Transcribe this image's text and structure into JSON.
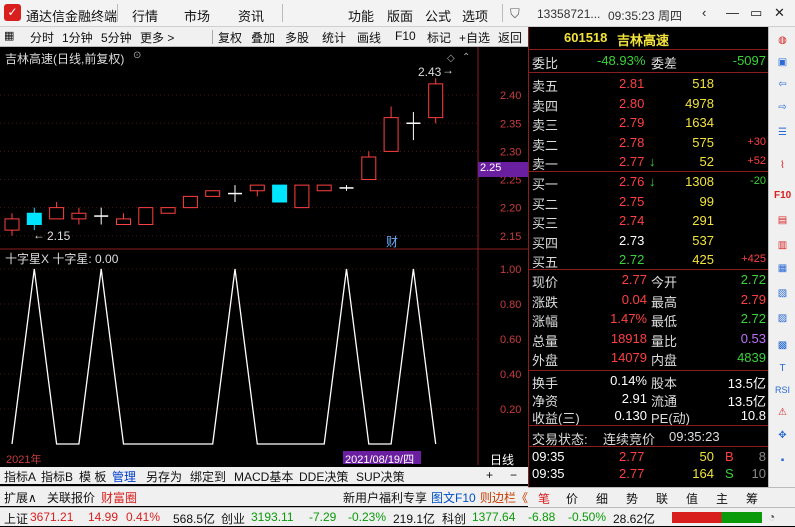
{
  "app": {
    "title": "通达信金融终端",
    "menus": [
      "行情",
      "市场",
      "资讯",
      "功能",
      "版面",
      "公式",
      "选项"
    ],
    "account": "13358721...",
    "clock": "09:35:23 周四"
  },
  "toolbar": [
    "分时",
    "1分钟",
    "5分钟",
    "更多 >",
    "复权",
    "叠加",
    "多股",
    "统计",
    "画线",
    "F10",
    "标记",
    "+自选",
    "返回"
  ],
  "chart": {
    "title": "吉林高速(日线,前复权)",
    "indicator_title": "十字星X  十字星: 0.00",
    "price_high_note": "2.43",
    "price_low_note": "2.15",
    "current_price_tag": "2.25",
    "finance_marker": "财",
    "year_label": "2021年",
    "cursor_date": "2021/08/19/四",
    "period_label": "日线",
    "y_labels": [
      "2.40",
      "2.35",
      "2.30",
      "2.25",
      "2.20",
      "2.15"
    ],
    "ind_labels": [
      "1.00",
      "0.80",
      "0.60",
      "0.40",
      "0.20"
    ]
  },
  "chart_data": {
    "type": "candlestick",
    "candles": [
      {
        "o": 2.16,
        "c": 2.18,
        "h": 2.19,
        "l": 2.15
      },
      {
        "o": 2.19,
        "c": 2.17,
        "h": 2.2,
        "l": 2.16
      },
      {
        "o": 2.18,
        "c": 2.2,
        "h": 2.21,
        "l": 2.18
      },
      {
        "o": 2.18,
        "c": 2.19,
        "h": 2.2,
        "l": 2.17
      },
      {
        "o": 2.185,
        "c": 2.185,
        "h": 2.2,
        "l": 2.17
      },
      {
        "o": 2.17,
        "c": 2.18,
        "h": 2.19,
        "l": 2.17
      },
      {
        "o": 2.17,
        "c": 2.2,
        "h": 2.2,
        "l": 2.17
      },
      {
        "o": 2.19,
        "c": 2.2,
        "h": 2.2,
        "l": 2.19
      },
      {
        "o": 2.2,
        "c": 2.22,
        "h": 2.22,
        "l": 2.2
      },
      {
        "o": 2.22,
        "c": 2.23,
        "h": 2.23,
        "l": 2.22
      },
      {
        "o": 2.225,
        "c": 2.225,
        "h": 2.24,
        "l": 2.21
      },
      {
        "o": 2.23,
        "c": 2.24,
        "h": 2.24,
        "l": 2.22
      },
      {
        "o": 2.24,
        "c": 2.21,
        "h": 2.24,
        "l": 2.21
      },
      {
        "o": 2.2,
        "c": 2.24,
        "h": 2.24,
        "l": 2.2
      },
      {
        "o": 2.23,
        "c": 2.24,
        "h": 2.24,
        "l": 2.23
      },
      {
        "o": 2.235,
        "c": 2.235,
        "h": 2.24,
        "l": 2.23
      },
      {
        "o": 2.25,
        "c": 2.29,
        "h": 2.3,
        "l": 2.25
      },
      {
        "o": 2.3,
        "c": 2.36,
        "h": 2.38,
        "l": 2.3
      },
      {
        "o": 2.35,
        "c": 2.35,
        "h": 2.37,
        "l": 2.32
      },
      {
        "o": 2.36,
        "c": 2.42,
        "h": 2.43,
        "l": 2.35
      }
    ],
    "indicator": {
      "name": "十字星",
      "values": [
        0,
        1,
        0,
        0,
        1,
        0,
        0,
        0,
        0,
        0,
        1,
        0,
        0,
        0,
        0,
        1,
        0,
        0,
        1,
        0
      ]
    },
    "ylim": [
      2.13,
      2.45
    ]
  },
  "tabs": {
    "row1": [
      "指标A",
      "指标B",
      "模 板",
      "管理",
      "另存为",
      "绑定到",
      "MACD基本",
      "DDE决策",
      "SUP决策"
    ],
    "row2": [
      "扩展∧",
      "关联报价",
      "财富圈"
    ]
  },
  "quote": {
    "code": "601518",
    "name": "吉林高速",
    "weibi_label": "委比",
    "weibi": "-48.93%",
    "weicha_label": "委差",
    "weicha": "-5097",
    "asks": [
      {
        "label": "卖五",
        "price": "2.81",
        "vol": "518",
        "chg": ""
      },
      {
        "label": "卖四",
        "price": "2.80",
        "vol": "4978",
        "chg": ""
      },
      {
        "label": "卖三",
        "price": "2.79",
        "vol": "1634",
        "chg": ""
      },
      {
        "label": "卖二",
        "price": "2.78",
        "vol": "575",
        "chg": "+30"
      },
      {
        "label": "卖一",
        "price": "2.77",
        "vol": "52",
        "chg": "+52",
        "arrow": "↓"
      }
    ],
    "bids": [
      {
        "label": "买一",
        "price": "2.76",
        "vol": "1308",
        "chg": "-20",
        "arrow": "↓"
      },
      {
        "label": "买二",
        "price": "2.75",
        "vol": "99",
        "chg": ""
      },
      {
        "label": "买三",
        "price": "2.74",
        "vol": "291",
        "chg": ""
      },
      {
        "label": "买四",
        "price": "2.73",
        "vol": "537",
        "chg": ""
      },
      {
        "label": "买五",
        "price": "2.72",
        "vol": "425",
        "chg": "+425"
      }
    ],
    "stats": [
      [
        "现价",
        "2.77",
        "今开",
        "2.72"
      ],
      [
        "涨跌",
        "0.04",
        "最高",
        "2.79"
      ],
      [
        "涨幅",
        "1.47%",
        "最低",
        "2.72"
      ],
      [
        "总量",
        "18918",
        "量比",
        "0.53"
      ],
      [
        "外盘",
        "14079",
        "内盘",
        "4839"
      ]
    ],
    "stats2": [
      [
        "换手",
        "0.14%",
        "股本",
        "13.5亿"
      ],
      [
        "净资",
        "2.91",
        "流通",
        "13.5亿"
      ],
      [
        "收益(三)",
        "0.130",
        "PE(动)",
        "10.8"
      ]
    ],
    "trade_state_label": "交易状态:",
    "trade_state": "连续竞价",
    "trade_time": "09:35:23",
    "ticks": [
      {
        "time": "09:35",
        "price": "2.77",
        "vol": "50",
        "side": "B",
        "n": "8"
      },
      {
        "time": "09:35",
        "price": "2.77",
        "vol": "164",
        "side": "S",
        "n": "10"
      }
    ]
  },
  "quotetabs": [
    "笔",
    "价",
    "细",
    "势",
    "联",
    "值",
    "主",
    "筹"
  ],
  "news": {
    "ad": "新用户福利专享",
    "f10": "图文F10",
    "link": "则边栏《"
  },
  "status": {
    "sh_label": "上证",
    "sh": "3671.21",
    "sh_chg": "14.99",
    "sh_pct": "0.41%",
    "sh_amt": "568.5亿",
    "cy_label": "创业",
    "cy": "3193.11",
    "cy_chg": "-7.29",
    "cy_pct": "-0.23%",
    "cy_amt": "219.1亿",
    "kc_label": "科创",
    "kc": "1377.64",
    "kc_chg": "-6.88",
    "kc_pct": "-0.50%",
    "kc_amt": "28.62亿"
  },
  "colors": {
    "up": "#ff4040",
    "down": "#00e5ff",
    "grid": "#8a1e1e",
    "accent": "#d91e1e"
  }
}
